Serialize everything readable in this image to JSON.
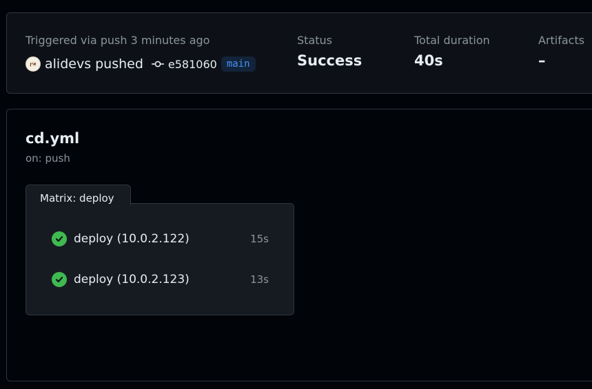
{
  "summary": {
    "trigger_text": "Triggered via push 3 minutes ago",
    "avatar_text": "אין",
    "actor": "alidevs",
    "action": "pushed",
    "commit_icon": "git-commit-icon",
    "commit_sha": "e581060",
    "branch": "main",
    "status": {
      "label": "Status",
      "value": "Success"
    },
    "duration": {
      "label": "Total duration",
      "value": "40s"
    },
    "artifacts": {
      "label": "Artifacts",
      "value": "–"
    }
  },
  "workflow": {
    "file": "cd.yml",
    "trigger": "on: push",
    "matrix": {
      "label": "Matrix: deploy",
      "jobs": [
        {
          "name": "deploy (10.0.2.122)",
          "duration": "15s",
          "status_icon": "check-circle-icon"
        },
        {
          "name": "deploy (10.0.2.123)",
          "duration": "13s",
          "status_icon": "check-circle-icon"
        }
      ]
    }
  },
  "colors": {
    "background": "#010409",
    "card": "#0d1117",
    "border": "#30363d",
    "success": "#3fb950",
    "branch_accent": "#4493f8",
    "muted_text": "#8b949e"
  }
}
